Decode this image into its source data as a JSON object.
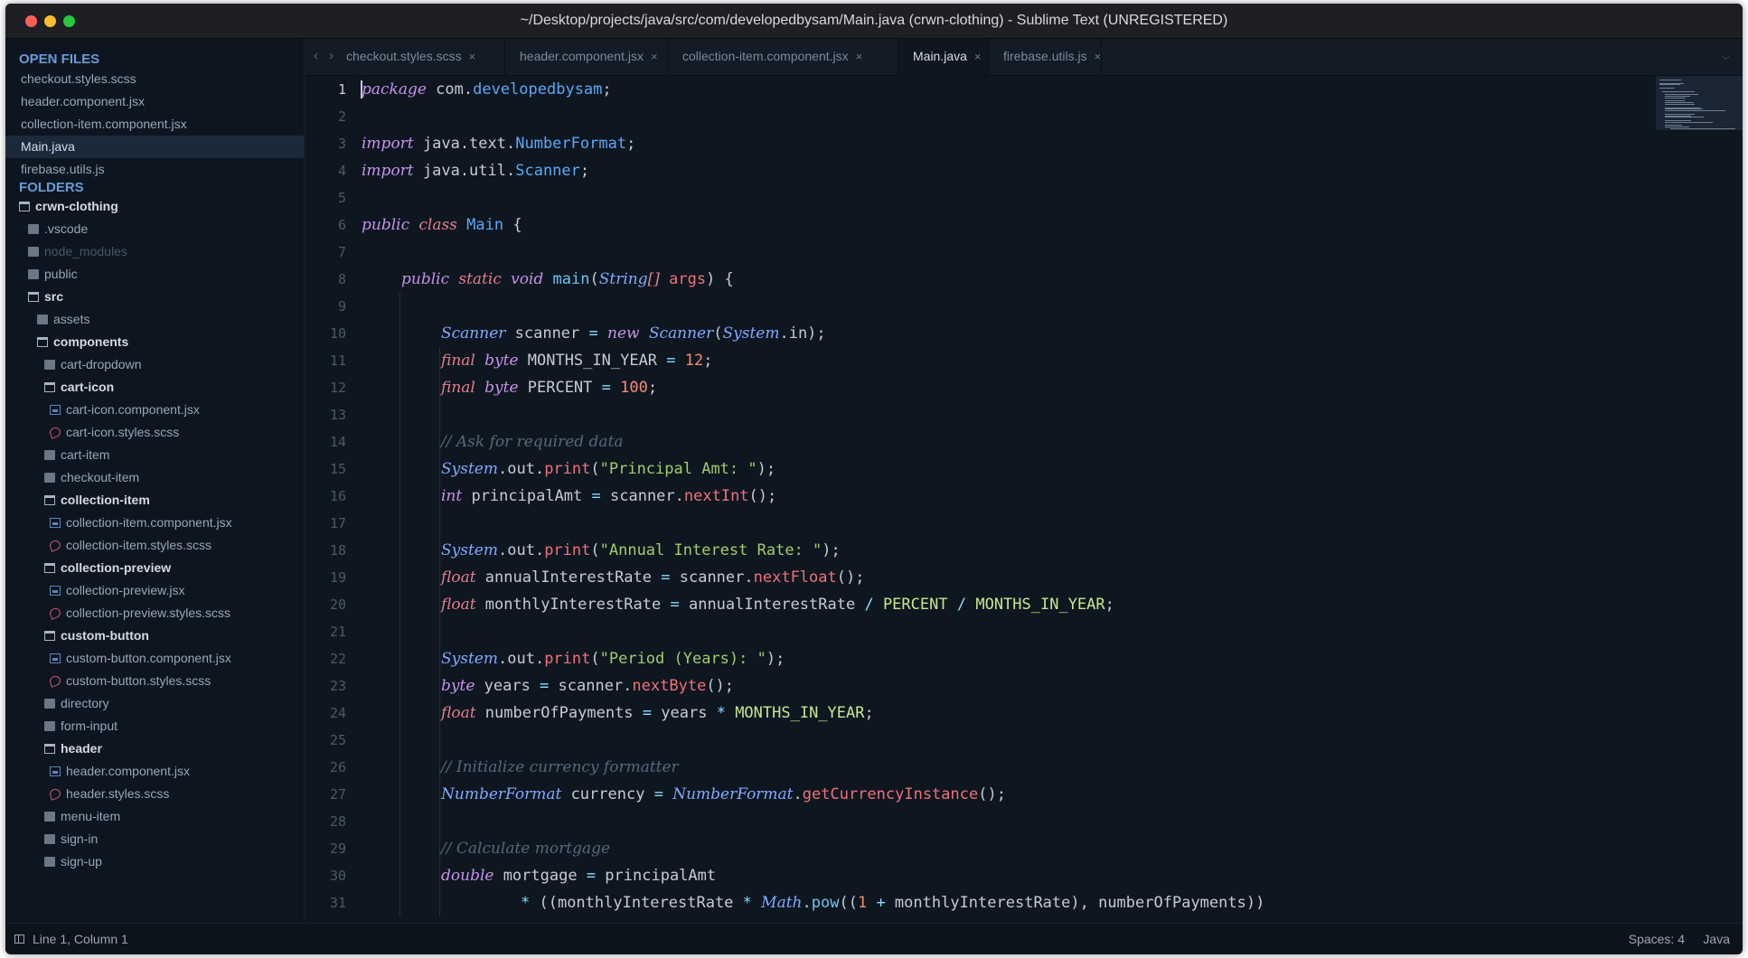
{
  "window": {
    "title": "~/Desktop/projects/java/src/com/developedbysam/Main.java (crwn-clothing) - Sublime Text (UNREGISTERED)"
  },
  "sidebar": {
    "open_files_heading": "OPEN FILES",
    "open_files": [
      {
        "label": "checkout.styles.scss",
        "active": false
      },
      {
        "label": "header.component.jsx",
        "active": false
      },
      {
        "label": "collection-item.component.jsx",
        "active": false
      },
      {
        "label": "Main.java",
        "active": true
      },
      {
        "label": "firebase.utils.js",
        "active": false
      }
    ],
    "folders_heading": "FOLDERS",
    "tree": [
      {
        "label": "crwn-clothing",
        "icon": "folder-open",
        "bold": true,
        "dim": false,
        "indent": 0
      },
      {
        "label": ".vscode",
        "icon": "folder",
        "bold": false,
        "dim": false,
        "indent": 1
      },
      {
        "label": "node_modules",
        "icon": "folder",
        "bold": false,
        "dim": true,
        "indent": 1
      },
      {
        "label": "public",
        "icon": "folder",
        "bold": false,
        "dim": false,
        "indent": 1
      },
      {
        "label": "src",
        "icon": "folder-open",
        "bold": true,
        "dim": false,
        "indent": 1
      },
      {
        "label": "assets",
        "icon": "folder",
        "bold": false,
        "dim": false,
        "indent": 2
      },
      {
        "label": "components",
        "icon": "folder-open",
        "bold": true,
        "dim": false,
        "indent": 2
      },
      {
        "label": "cart-dropdown",
        "icon": "folder",
        "bold": false,
        "dim": false,
        "indent": 3
      },
      {
        "label": "cart-icon",
        "icon": "folder-open",
        "bold": true,
        "dim": false,
        "indent": 3
      },
      {
        "label": "cart-icon.component.jsx",
        "icon": "file-jsx",
        "bold": false,
        "dim": false,
        "indent": 4
      },
      {
        "label": "cart-icon.styles.scss",
        "icon": "file-scss",
        "bold": false,
        "dim": false,
        "indent": 4
      },
      {
        "label": "cart-item",
        "icon": "folder",
        "bold": false,
        "dim": false,
        "indent": 3
      },
      {
        "label": "checkout-item",
        "icon": "folder",
        "bold": false,
        "dim": false,
        "indent": 3
      },
      {
        "label": "collection-item",
        "icon": "folder-open",
        "bold": true,
        "dim": false,
        "indent": 3
      },
      {
        "label": "collection-item.component.jsx",
        "icon": "file-jsx",
        "bold": false,
        "dim": false,
        "indent": 4
      },
      {
        "label": "collection-item.styles.scss",
        "icon": "file-scss",
        "bold": false,
        "dim": false,
        "indent": 4
      },
      {
        "label": "collection-preview",
        "icon": "folder-open",
        "bold": true,
        "dim": false,
        "indent": 3
      },
      {
        "label": "collection-preview.jsx",
        "icon": "file-jsx",
        "bold": false,
        "dim": false,
        "indent": 4
      },
      {
        "label": "collection-preview.styles.scss",
        "icon": "file-scss",
        "bold": false,
        "dim": false,
        "indent": 4
      },
      {
        "label": "custom-button",
        "icon": "folder-open",
        "bold": true,
        "dim": false,
        "indent": 3
      },
      {
        "label": "custom-button.component.jsx",
        "icon": "file-jsx",
        "bold": false,
        "dim": false,
        "indent": 4
      },
      {
        "label": "custom-button.styles.scss",
        "icon": "file-scss",
        "bold": false,
        "dim": false,
        "indent": 4
      },
      {
        "label": "directory",
        "icon": "folder",
        "bold": false,
        "dim": false,
        "indent": 3
      },
      {
        "label": "form-input",
        "icon": "folder",
        "bold": false,
        "dim": false,
        "indent": 3
      },
      {
        "label": "header",
        "icon": "folder-open",
        "bold": true,
        "dim": false,
        "indent": 3
      },
      {
        "label": "header.component.jsx",
        "icon": "file-jsx",
        "bold": false,
        "dim": false,
        "indent": 4
      },
      {
        "label": "header.styles.scss",
        "icon": "file-scss",
        "bold": false,
        "dim": false,
        "indent": 4
      },
      {
        "label": "menu-item",
        "icon": "folder",
        "bold": false,
        "dim": false,
        "indent": 3
      },
      {
        "label": "sign-in",
        "icon": "folder",
        "bold": false,
        "dim": false,
        "indent": 3
      },
      {
        "label": "sign-up",
        "icon": "folder",
        "bold": false,
        "dim": false,
        "indent": 3
      }
    ]
  },
  "tabs": {
    "back_label": "‹",
    "forward_label": "›",
    "items": [
      {
        "label": "checkout.styles.scss",
        "close": "×",
        "active": false
      },
      {
        "label": "header.component.jsx",
        "close": "×",
        "active": false
      },
      {
        "label": "collection-item.component.jsx",
        "close": "×",
        "active": false
      },
      {
        "label": "Main.java",
        "close": "×",
        "active": true
      },
      {
        "label": "firebase.utils.js",
        "close": "×",
        "active": false
      }
    ],
    "overflow_icon": "chevron-down-icon"
  },
  "editor": {
    "current_line": 1,
    "lines": [
      {
        "n": "1",
        "indent": 0,
        "tokens": [
          [
            "kw",
            "package"
          ],
          [
            "plain",
            " com."
          ],
          [
            "cls",
            "developedbysam"
          ],
          [
            "plain",
            ";"
          ]
        ]
      },
      {
        "n": "2",
        "indent": 0,
        "tokens": []
      },
      {
        "n": "3",
        "indent": 0,
        "tokens": [
          [
            "kw",
            "import"
          ],
          [
            "plain",
            " java.text."
          ],
          [
            "cls",
            "NumberFormat"
          ],
          [
            "plain",
            ";"
          ]
        ]
      },
      {
        "n": "4",
        "indent": 0,
        "tokens": [
          [
            "kw",
            "import"
          ],
          [
            "plain",
            " java.util."
          ],
          [
            "cls",
            "Scanner"
          ],
          [
            "plain",
            ";"
          ]
        ]
      },
      {
        "n": "5",
        "indent": 0,
        "tokens": []
      },
      {
        "n": "6",
        "indent": 0,
        "tokens": [
          [
            "kw",
            "public"
          ],
          [
            "plain",
            " "
          ],
          [
            "kw2",
            "class"
          ],
          [
            "plain",
            " "
          ],
          [
            "cls",
            "Main"
          ],
          [
            "plain",
            " {"
          ]
        ]
      },
      {
        "n": "7",
        "indent": 0,
        "tokens": []
      },
      {
        "n": "8",
        "indent": 1,
        "tokens": [
          [
            "kw",
            "public"
          ],
          [
            "plain",
            " "
          ],
          [
            "kw2",
            "static"
          ],
          [
            "plain",
            " "
          ],
          [
            "kw",
            "void"
          ],
          [
            "plain",
            " "
          ],
          [
            "fn2",
            "main"
          ],
          [
            "plain",
            "("
          ],
          [
            "type",
            "String"
          ],
          [
            "kw2",
            "[]"
          ],
          [
            "plain",
            " "
          ],
          [
            "fn",
            "args"
          ],
          [
            "plain",
            ") {"
          ]
        ]
      },
      {
        "n": "9",
        "indent": 1,
        "tokens": []
      },
      {
        "n": "10",
        "indent": 2,
        "tokens": [
          [
            "type",
            "Scanner"
          ],
          [
            "plain",
            " scanner "
          ],
          [
            "op",
            "="
          ],
          [
            "plain",
            " "
          ],
          [
            "kw",
            "new"
          ],
          [
            "plain",
            " "
          ],
          [
            "type",
            "Scanner"
          ],
          [
            "plain",
            "("
          ],
          [
            "type",
            "System"
          ],
          [
            "plain",
            ".in);"
          ]
        ]
      },
      {
        "n": "11",
        "indent": 2,
        "tokens": [
          [
            "kw2",
            "final"
          ],
          [
            "plain",
            " "
          ],
          [
            "kw",
            "byte"
          ],
          [
            "plain",
            " MONTHS_IN_YEAR "
          ],
          [
            "op",
            "="
          ],
          [
            "plain",
            " "
          ],
          [
            "num",
            "12"
          ],
          [
            "plain",
            ";"
          ]
        ]
      },
      {
        "n": "12",
        "indent": 2,
        "tokens": [
          [
            "kw2",
            "final"
          ],
          [
            "plain",
            " "
          ],
          [
            "kw",
            "byte"
          ],
          [
            "plain",
            " PERCENT "
          ],
          [
            "op",
            "="
          ],
          [
            "plain",
            " "
          ],
          [
            "num",
            "100"
          ],
          [
            "plain",
            ";"
          ]
        ]
      },
      {
        "n": "13",
        "indent": 2,
        "tokens": []
      },
      {
        "n": "14",
        "indent": 2,
        "tokens": [
          [
            "com",
            "// Ask for required data"
          ]
        ]
      },
      {
        "n": "15",
        "indent": 2,
        "tokens": [
          [
            "type",
            "System"
          ],
          [
            "plain",
            ".out."
          ],
          [
            "fn",
            "print"
          ],
          [
            "plain",
            "("
          ],
          [
            "str",
            "\"Principal Amt: \""
          ],
          [
            "plain",
            ");"
          ]
        ]
      },
      {
        "n": "16",
        "indent": 2,
        "tokens": [
          [
            "kw",
            "int"
          ],
          [
            "plain",
            " principalAmt "
          ],
          [
            "op",
            "="
          ],
          [
            "plain",
            " scanner."
          ],
          [
            "fn",
            "nextInt"
          ],
          [
            "plain",
            "();"
          ]
        ]
      },
      {
        "n": "17",
        "indent": 2,
        "tokens": []
      },
      {
        "n": "18",
        "indent": 2,
        "tokens": [
          [
            "type",
            "System"
          ],
          [
            "plain",
            ".out."
          ],
          [
            "fn",
            "print"
          ],
          [
            "plain",
            "("
          ],
          [
            "str",
            "\"Annual Interest Rate: \""
          ],
          [
            "plain",
            ");"
          ]
        ]
      },
      {
        "n": "19",
        "indent": 2,
        "tokens": [
          [
            "kw2",
            "float"
          ],
          [
            "plain",
            " annualInterestRate "
          ],
          [
            "op",
            "="
          ],
          [
            "plain",
            " scanner."
          ],
          [
            "fn",
            "nextFloat"
          ],
          [
            "plain",
            "();"
          ]
        ]
      },
      {
        "n": "20",
        "indent": 2,
        "tokens": [
          [
            "kw2",
            "float"
          ],
          [
            "plain",
            " monthlyInterestRate "
          ],
          [
            "op",
            "="
          ],
          [
            "plain",
            " annualInterestRate "
          ],
          [
            "op",
            "/"
          ],
          [
            "plain",
            " "
          ],
          [
            "const",
            "PERCENT"
          ],
          [
            "plain",
            " "
          ],
          [
            "op",
            "/"
          ],
          [
            "plain",
            " "
          ],
          [
            "const",
            "MONTHS_IN_YEAR"
          ],
          [
            "plain",
            ";"
          ]
        ]
      },
      {
        "n": "21",
        "indent": 2,
        "tokens": []
      },
      {
        "n": "22",
        "indent": 2,
        "tokens": [
          [
            "type",
            "System"
          ],
          [
            "plain",
            ".out."
          ],
          [
            "fn",
            "print"
          ],
          [
            "plain",
            "("
          ],
          [
            "str",
            "\"Period (Years): \""
          ],
          [
            "plain",
            ");"
          ]
        ]
      },
      {
        "n": "23",
        "indent": 2,
        "tokens": [
          [
            "kw",
            "byte"
          ],
          [
            "plain",
            " years "
          ],
          [
            "op",
            "="
          ],
          [
            "plain",
            " scanner."
          ],
          [
            "fn",
            "nextByte"
          ],
          [
            "plain",
            "();"
          ]
        ]
      },
      {
        "n": "24",
        "indent": 2,
        "tokens": [
          [
            "kw2",
            "float"
          ],
          [
            "plain",
            " numberOfPayments "
          ],
          [
            "op",
            "="
          ],
          [
            "plain",
            " years "
          ],
          [
            "op",
            "*"
          ],
          [
            "plain",
            " "
          ],
          [
            "const",
            "MONTHS_IN_YEAR"
          ],
          [
            "plain",
            ";"
          ]
        ]
      },
      {
        "n": "25",
        "indent": 2,
        "tokens": []
      },
      {
        "n": "26",
        "indent": 2,
        "tokens": [
          [
            "com",
            "// Initialize currency formatter"
          ]
        ]
      },
      {
        "n": "27",
        "indent": 2,
        "tokens": [
          [
            "type",
            "NumberFormat"
          ],
          [
            "plain",
            " currency "
          ],
          [
            "op",
            "="
          ],
          [
            "plain",
            " "
          ],
          [
            "type",
            "NumberFormat"
          ],
          [
            "plain",
            "."
          ],
          [
            "fn",
            "getCurrencyInstance"
          ],
          [
            "plain",
            "();"
          ]
        ]
      },
      {
        "n": "28",
        "indent": 2,
        "tokens": []
      },
      {
        "n": "29",
        "indent": 2,
        "tokens": [
          [
            "com",
            "// Calculate mortgage"
          ]
        ]
      },
      {
        "n": "30",
        "indent": 2,
        "tokens": [
          [
            "kw",
            "double"
          ],
          [
            "plain",
            " mortgage "
          ],
          [
            "op",
            "="
          ],
          [
            "plain",
            " principalAmt"
          ]
        ]
      },
      {
        "n": "31",
        "indent": 4,
        "tokens": [
          [
            "op",
            "*"
          ],
          [
            "plain",
            " ((monthlyInterestRate "
          ],
          [
            "op",
            "*"
          ],
          [
            "plain",
            " "
          ],
          [
            "type",
            "Math"
          ],
          [
            "plain",
            "."
          ],
          [
            "fn2",
            "pow"
          ],
          [
            "plain",
            "(("
          ],
          [
            "num",
            "1"
          ],
          [
            "plain",
            " "
          ],
          [
            "op",
            "+"
          ],
          [
            "plain",
            " monthlyInterestRate), numberOfPayments))"
          ]
        ]
      }
    ]
  },
  "statusbar": {
    "position": "Line 1, Column 1",
    "spaces": "Spaces: 4",
    "syntax": "Java"
  },
  "colors": {
    "editor_bg": "#0e1620",
    "sidebar_bg": "#0c1520",
    "keyword": "#c792ea",
    "string": "#9ece6a",
    "number": "#f78c6c",
    "class": "#5aa9f6",
    "comment": "#56687c"
  }
}
